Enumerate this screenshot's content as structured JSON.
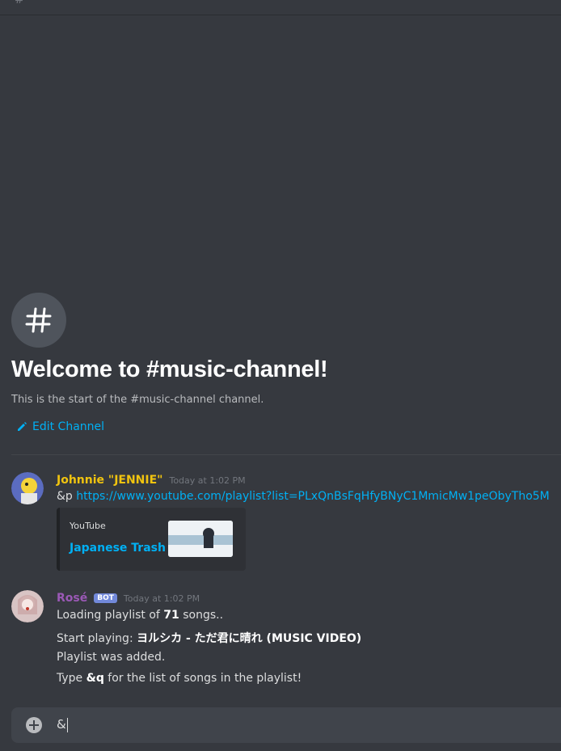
{
  "welcome": {
    "title": "Welcome to #music-channel!",
    "subtitle": "This is the start of the #music-channel channel.",
    "edit_label": "Edit Channel"
  },
  "messages": [
    {
      "username": "Johnnie \"JENNIE\"",
      "username_color": "#f1c40f",
      "timestamp": "Today at 1:02 PM",
      "prefix": "&p",
      "link": "https://www.youtube.com/playlist?list=PLxQnBsFqHfyBNyC1MmicMw1peObyTho5M",
      "embed": {
        "provider": "YouTube",
        "title": "Japanese Trash"
      }
    },
    {
      "username": "Rosé",
      "username_color": "#9b59b6",
      "bot_tag": "BOT",
      "timestamp": "Today at 1:02 PM",
      "line1_pre": "Loading playlist of ",
      "line1_bold": "71",
      "line1_post": " songs..",
      "line2_pre": "Start playing: ",
      "line2_bold": "ヨルシカ - ただ君に晴れ (MUSIC VIDEO)",
      "line3": "Playlist was added.",
      "line4_pre": "Type ",
      "line4_bold": "&q",
      "line4_post": " for the list of songs in the playlist!"
    }
  ],
  "composer": {
    "value": "&"
  },
  "colors": {
    "background": "#36393f",
    "link": "#00b0f4",
    "bot_tag": "#7289da"
  }
}
